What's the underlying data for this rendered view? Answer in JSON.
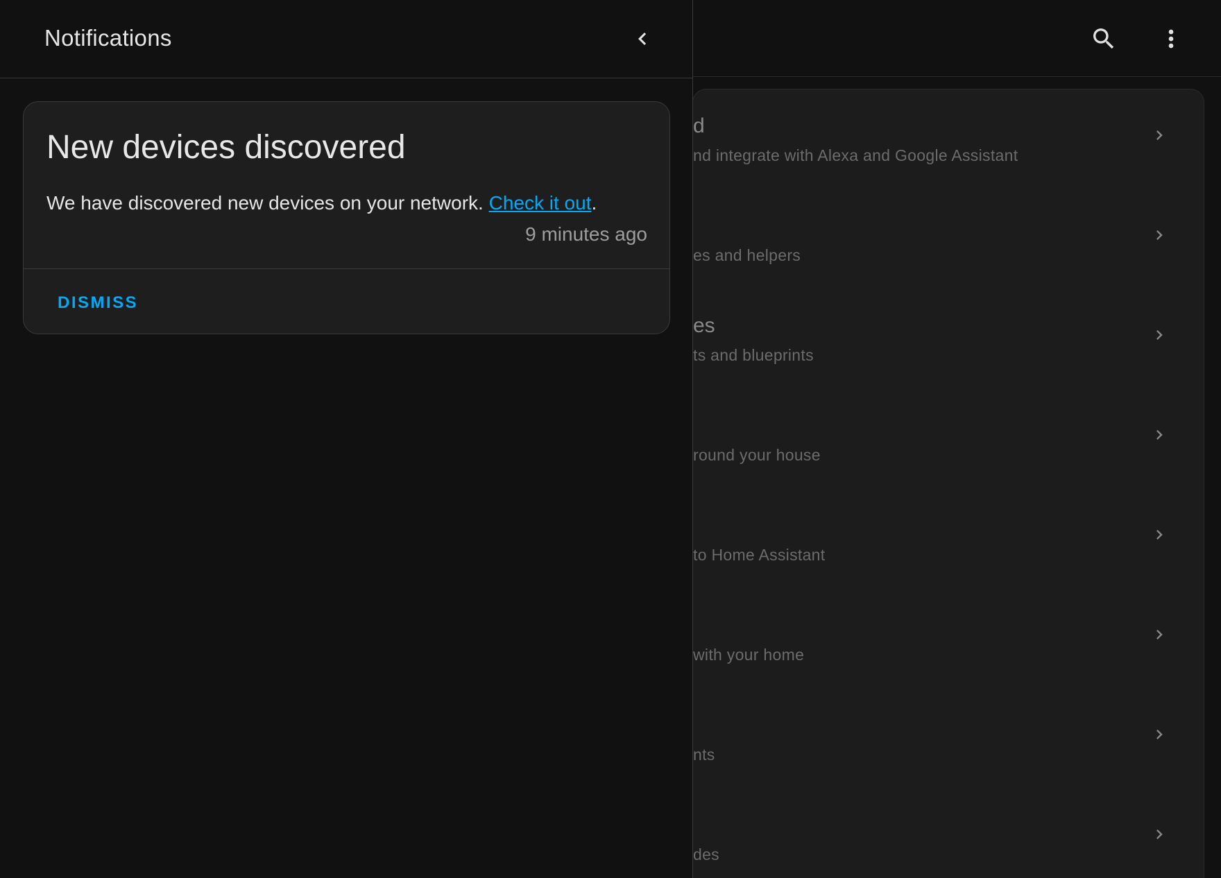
{
  "drawer": {
    "title": "Notifications",
    "back_icon": "chevron-left-icon"
  },
  "notification": {
    "title": "New devices discovered",
    "message_before": "We have discovered new devices on your network. ",
    "link_text": "Check it out",
    "message_after": ".",
    "time": "9 minutes ago",
    "dismiss_label": "DISMISS"
  },
  "background": {
    "header_icons": [
      "search-icon",
      "dots-vertical-icon"
    ],
    "rows": [
      {
        "title": "d",
        "subtitle": "nd integrate with Alexa and Google Assistant"
      },
      {
        "title": "",
        "subtitle": "es and helpers"
      },
      {
        "title": "es",
        "subtitle": "ts and blueprints"
      },
      {
        "title": "",
        "subtitle": "round your house"
      },
      {
        "title": "",
        "subtitle": "to Home Assistant"
      },
      {
        "title": "",
        "subtitle": "with your home"
      },
      {
        "title": "",
        "subtitle": "nts"
      },
      {
        "title": "",
        "subtitle": "des"
      }
    ]
  },
  "colors": {
    "accent": "#03a9f4",
    "background": "#111111",
    "card": "#1e1e1e",
    "divider": "#3a3a3a"
  }
}
